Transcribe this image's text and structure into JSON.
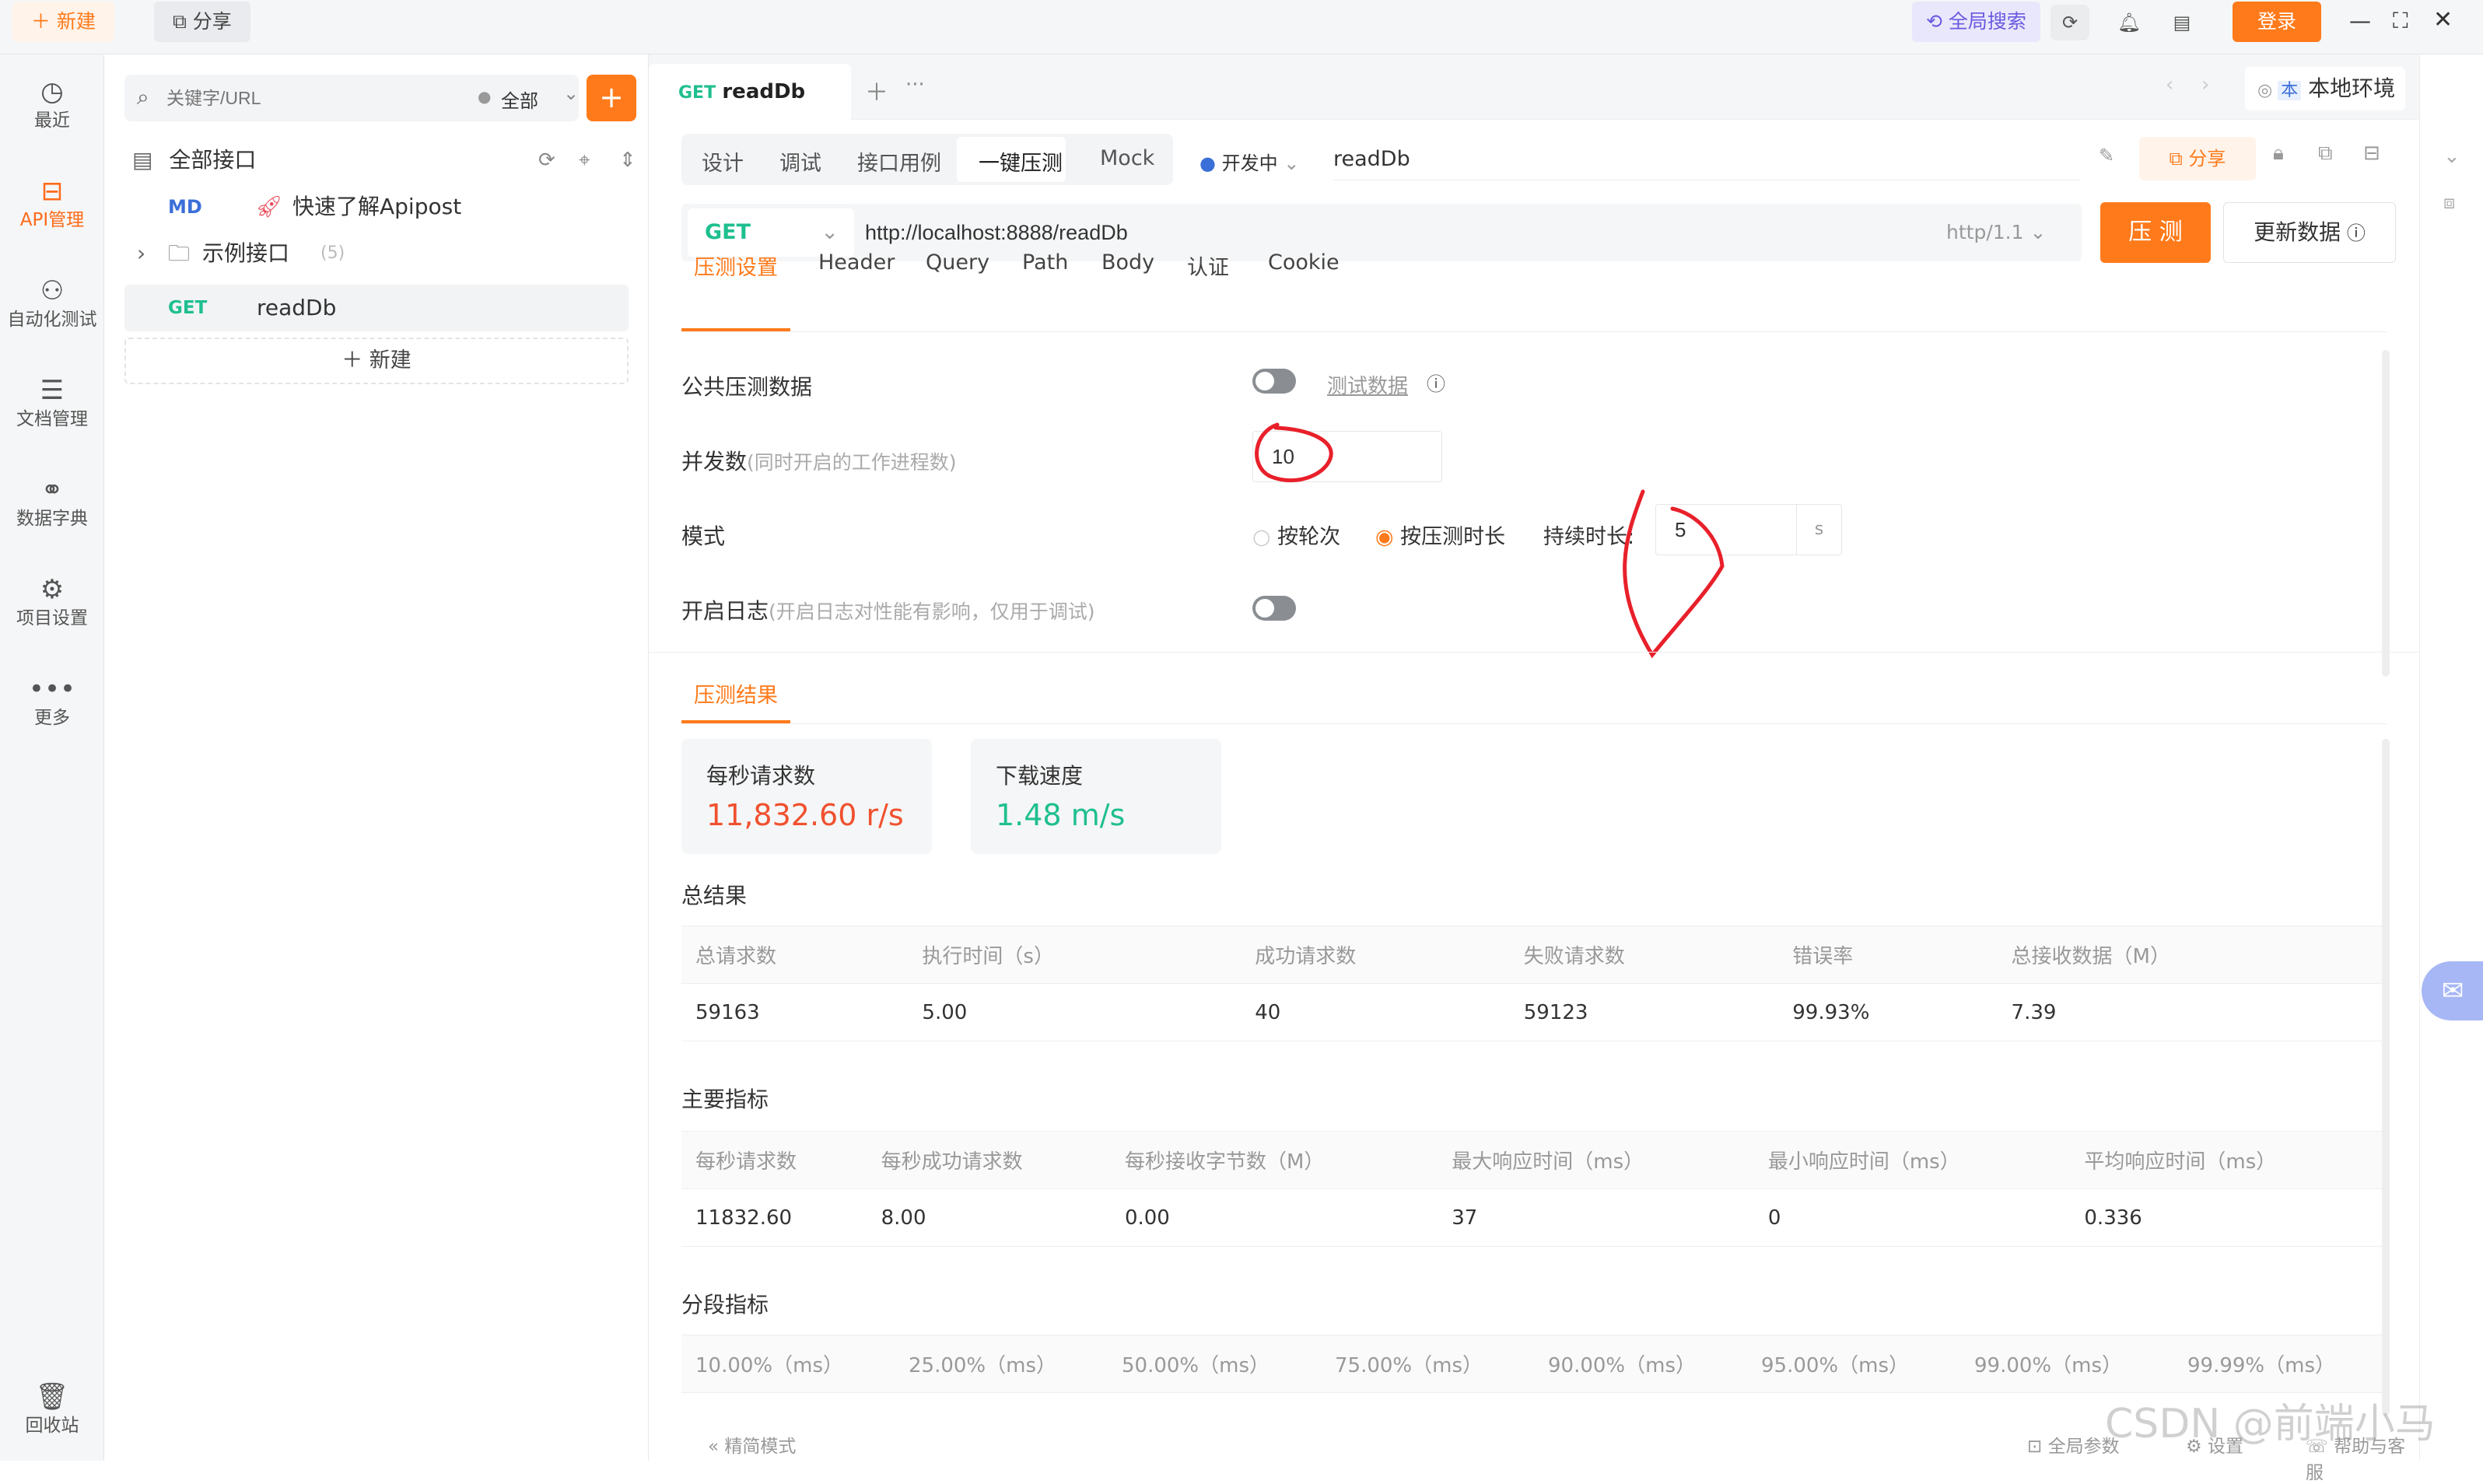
{
  "topbar": {
    "new_label": "新建",
    "share_label": "分享",
    "global_search": "全局搜索",
    "login": "登录",
    "sync_icon": "sync-icon",
    "bell_icon": "bell-icon",
    "panel_icon": "panel-icon"
  },
  "leftnav": {
    "items": [
      {
        "label": "最近",
        "icon": "clock-icon"
      },
      {
        "label": "API管理",
        "icon": "api-icon"
      },
      {
        "label": "自动化测试",
        "icon": "automation-icon"
      },
      {
        "label": "文档管理",
        "icon": "document-icon"
      },
      {
        "label": "数据字典",
        "icon": "dictionary-icon"
      },
      {
        "label": "项目设置",
        "icon": "settings-icon"
      },
      {
        "label": "更多",
        "icon": "more-icon"
      }
    ],
    "trash": "回收站"
  },
  "tree": {
    "search_placeholder": "关键字/URL",
    "filter_label": "全部",
    "all_interfaces": "全部接口",
    "items": [
      {
        "method": "MD",
        "label": "快速了解Apipost"
      },
      {
        "method": "",
        "label": "示例接口",
        "count": "(5)"
      },
      {
        "method": "GET",
        "label": "readDb"
      }
    ],
    "new_label": "新建"
  },
  "main": {
    "tab": {
      "method": "GET",
      "name": "readDb"
    },
    "env_label": "本地环境",
    "env_badge": "本",
    "mode_tabs": [
      "设计",
      "调试",
      "接口用例",
      "一键压测",
      "Mock"
    ],
    "status": "开发中",
    "title_value": "readDb",
    "share": "分享",
    "request": {
      "method": "GET",
      "url": "http://localhost:8888/readDb",
      "protocol": "http/1.1",
      "run_button": "压 测",
      "update_button": "更新数据"
    },
    "sub_tabs": [
      "压测设置",
      "Header",
      "Query",
      "Path",
      "Body",
      "认证",
      "Cookie"
    ],
    "settings": {
      "public_data_label": "公共压测数据",
      "test_data_link": "测试数据",
      "concurrency_label": "并发数",
      "concurrency_hint": "(同时开启的工作进程数)",
      "concurrency_value": "10",
      "mode_label": "模式",
      "mode_rounds": "按轮次",
      "mode_duration": "按压测时长",
      "duration_label": "持续时长:",
      "duration_value": "5",
      "duration_unit": "s",
      "log_label": "开启日志",
      "log_hint": "(开启日志对性能有影响，仅用于调试)"
    },
    "results_tab": "压测结果",
    "cards": [
      {
        "title": "每秒请求数",
        "value": "11,832.60 r/s",
        "color": "#f0502e"
      },
      {
        "title": "下载速度",
        "value": "1.48 m/s",
        "color": "#1fbf8f"
      }
    ],
    "summary": {
      "title": "总结果",
      "headers": [
        "总请求数",
        "执行时间（s）",
        "成功请求数",
        "失败请求数",
        "错误率",
        "总接收数据（M）"
      ],
      "row": [
        "59163",
        "5.00",
        "40",
        "59123",
        "99.93%",
        "7.39"
      ]
    },
    "key_metrics": {
      "title": "主要指标",
      "headers": [
        "每秒请求数",
        "每秒成功请求数",
        "每秒接收字节数（M）",
        "最大响应时间（ms）",
        "最小响应时间（ms）",
        "平均响应时间（ms）"
      ],
      "row": [
        "11832.60",
        "8.00",
        "0.00",
        "37",
        "0",
        "0.336"
      ]
    },
    "segment": {
      "title": "分段指标",
      "headers": [
        "10.00%（ms）",
        "25.00%（ms）",
        "50.00%（ms）",
        "75.00%（ms）",
        "90.00%（ms）",
        "95.00%（ms）",
        "99.00%（ms）",
        "99.99%（ms）"
      ]
    },
    "footer": {
      "compact_mode": "精简模式",
      "global_params": "全局参数",
      "settings": "设置",
      "help": "帮助与客服"
    }
  },
  "watermark": "CSDN @前端小马",
  "colors": {
    "accent": "#ff7a1a",
    "get": "#1fbf8f",
    "md": "#3a6fd8",
    "red_annotation": "#e8202a"
  }
}
